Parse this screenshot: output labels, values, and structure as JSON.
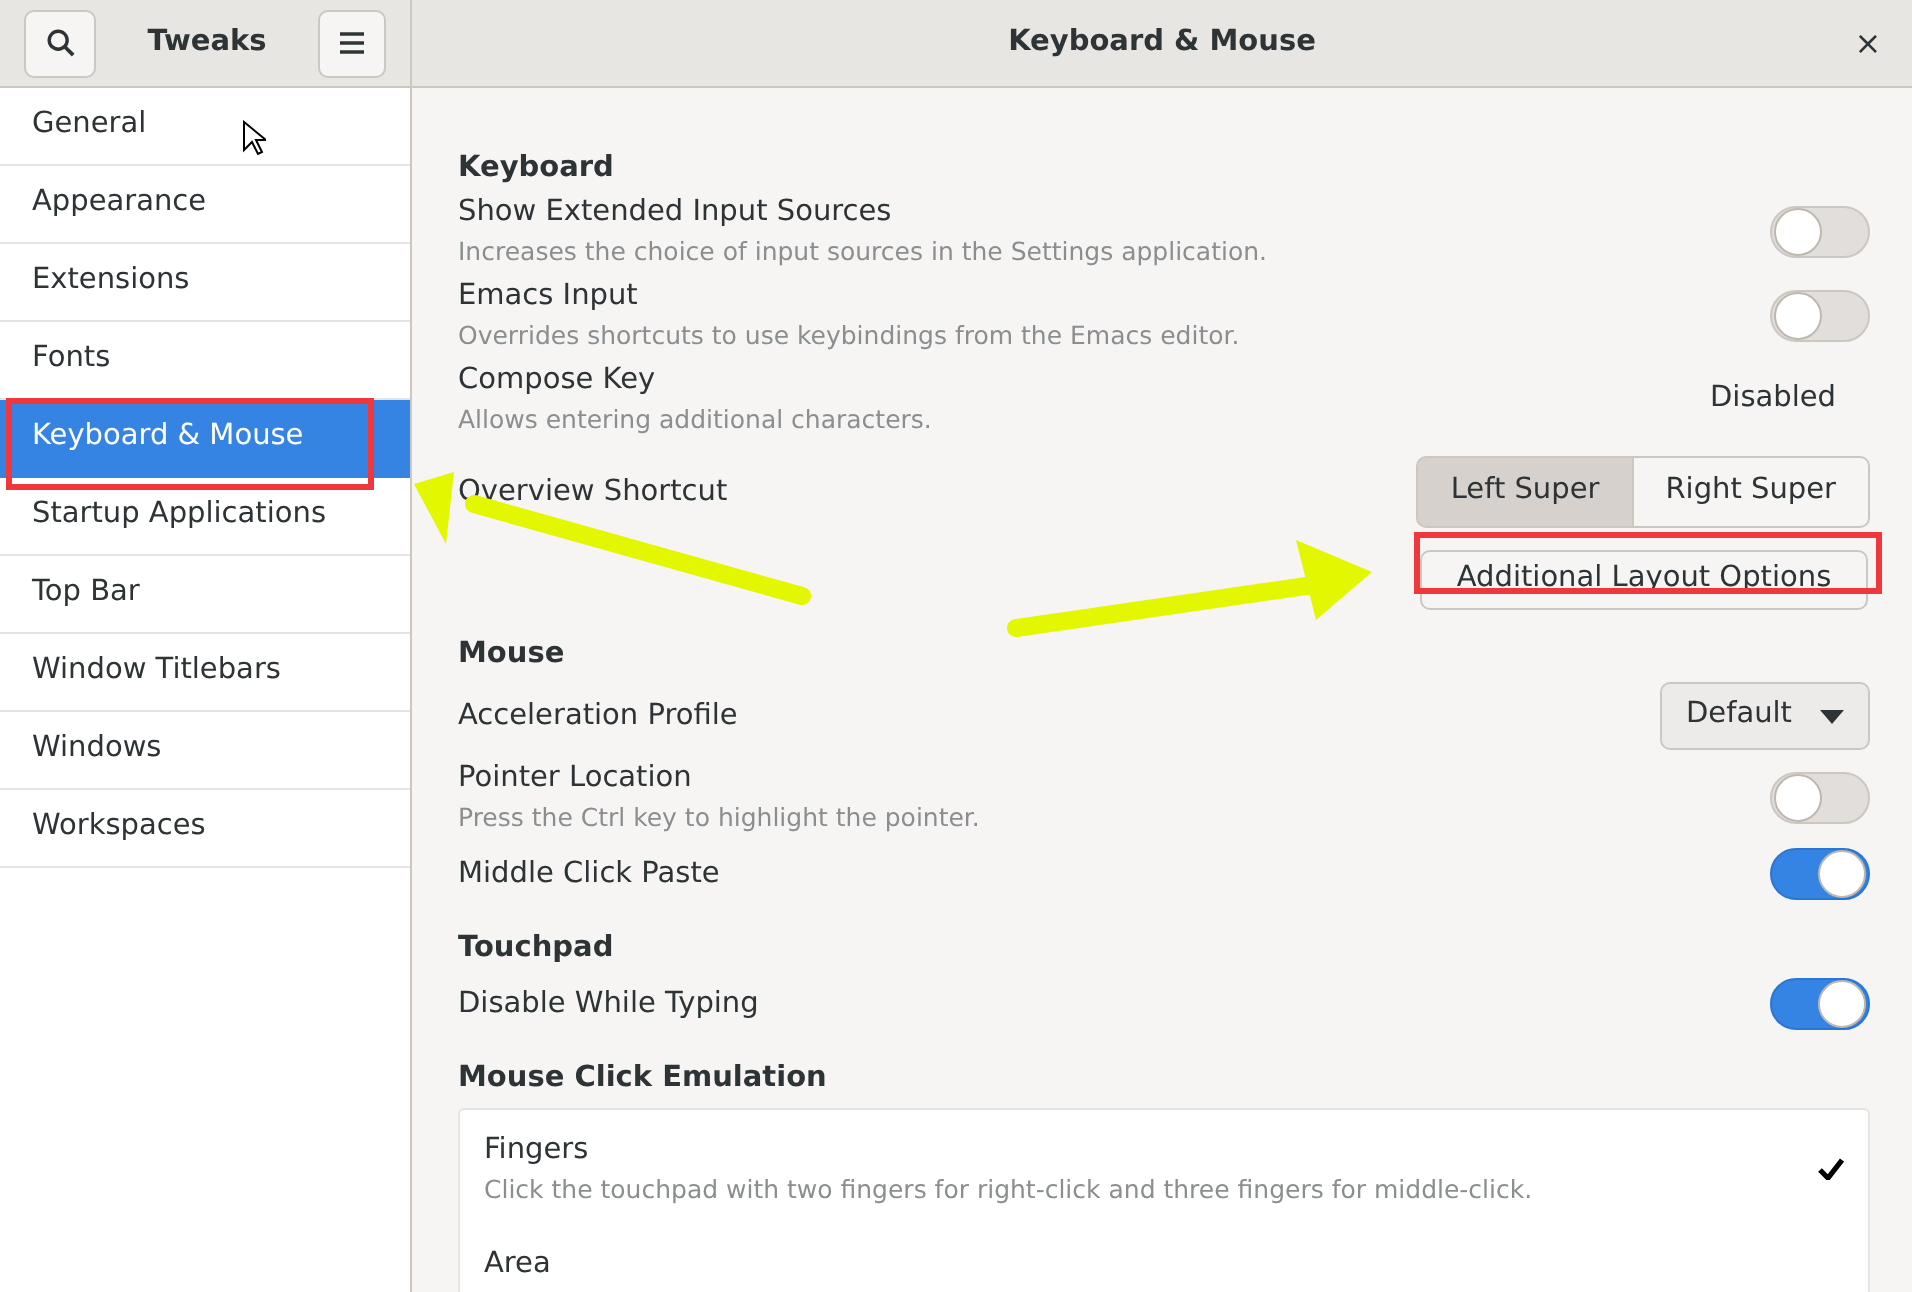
{
  "sidebar": {
    "title": "Tweaks",
    "items": [
      {
        "label": "General",
        "selected": false
      },
      {
        "label": "Appearance",
        "selected": false
      },
      {
        "label": "Extensions",
        "selected": false
      },
      {
        "label": "Fonts",
        "selected": false
      },
      {
        "label": "Keyboard & Mouse",
        "selected": true
      },
      {
        "label": "Startup Applications",
        "selected": false
      },
      {
        "label": "Top Bar",
        "selected": false
      },
      {
        "label": "Window Titlebars",
        "selected": false
      },
      {
        "label": "Windows",
        "selected": false
      },
      {
        "label": "Workspaces",
        "selected": false
      }
    ]
  },
  "window": {
    "title": "Keyboard & Mouse",
    "close": "×"
  },
  "sections": [
    {
      "heading": "Keyboard",
      "rows": [
        {
          "kind": "toggle",
          "title": "Show Extended Input Sources",
          "description": "Increases the choice of input sources in the Settings application.",
          "on": false
        },
        {
          "kind": "toggle",
          "title": "Emacs Input",
          "description": "Overrides shortcuts to use keybindings from the Emacs editor.",
          "on": false
        },
        {
          "kind": "value",
          "title": "Compose Key",
          "description": "Allows entering additional characters.",
          "value": "Disabled"
        },
        {
          "kind": "segmented",
          "title": "Overview Shortcut",
          "options": [
            {
              "label": "Left Super",
              "selected": true
            },
            {
              "label": "Right Super",
              "selected": false
            }
          ]
        },
        {
          "kind": "button",
          "label": "Additional Layout Options"
        }
      ]
    },
    {
      "heading": "Mouse",
      "rows": [
        {
          "kind": "dropdown",
          "title": "Acceleration Profile",
          "value": "Default"
        },
        {
          "kind": "toggle",
          "title": "Pointer Location",
          "description": "Press the Ctrl key to highlight the pointer.",
          "on": false
        },
        {
          "kind": "toggle",
          "title": "Middle Click Paste",
          "on": true
        }
      ]
    },
    {
      "heading": "Touchpad",
      "rows": [
        {
          "kind": "toggle",
          "title": "Disable While Typing",
          "on": true
        }
      ]
    },
    {
      "heading": "Mouse Click Emulation",
      "rows": [
        {
          "kind": "choices",
          "options": [
            {
              "title": "Fingers",
              "description": "Click the touchpad with two fingers for right-click and three fingers for middle-click.",
              "selected": true
            },
            {
              "title": "Area",
              "selected": false
            }
          ]
        }
      ]
    }
  ]
}
